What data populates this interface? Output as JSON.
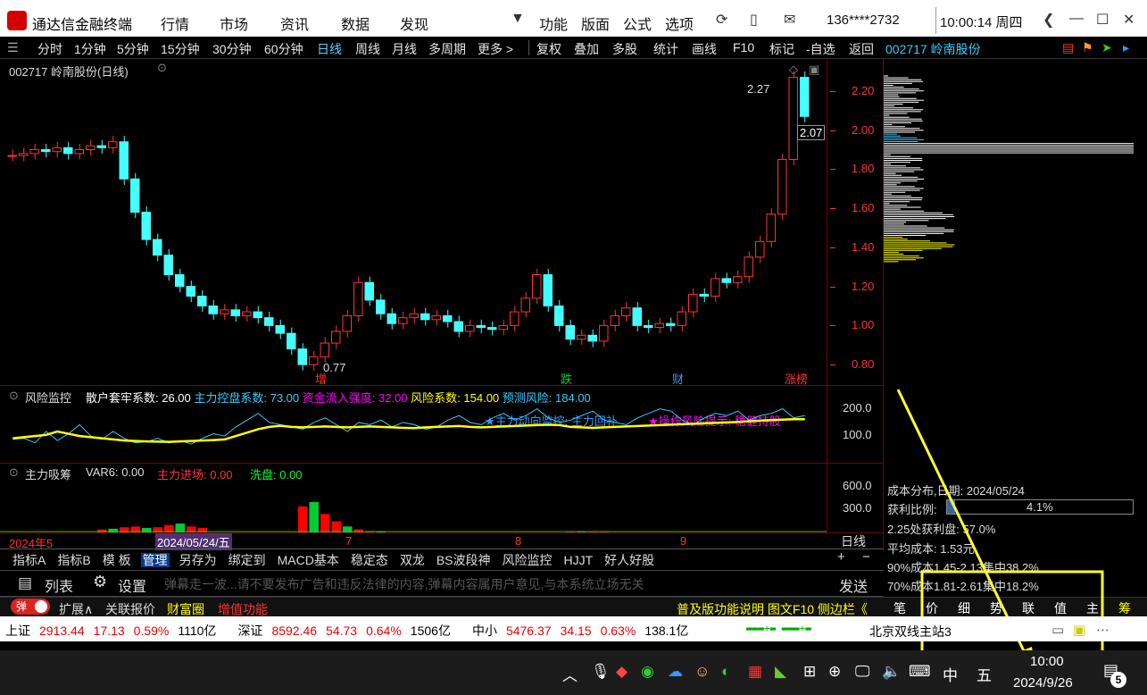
{
  "app": {
    "title": "通达信金融终端",
    "menus": [
      "行情",
      "市场",
      "资讯",
      "数据",
      "发现"
    ],
    "menus2": [
      "功能",
      "版面",
      "公式",
      "选项"
    ],
    "account": "136****2732",
    "time": "10:00:14 周四"
  },
  "periods": [
    "分时",
    "1分钟",
    "5分钟",
    "15分钟",
    "30分钟",
    "60分钟",
    "日线",
    "周线",
    "月线",
    "多周期",
    "更多 >"
  ],
  "tools": [
    "复权",
    "叠加",
    "多股",
    "统计",
    "画线",
    "F10",
    "标记",
    "-自选",
    "返回"
  ],
  "stock": {
    "header": "002717 岭南股份(日线)",
    "side_code": "002717 岭南股份",
    "high_label": "2.27",
    "low_label": "0.77",
    "last_label": "2.07",
    "yticks": [
      "2.20",
      "2.00",
      "1.80",
      "1.60",
      "1.40",
      "1.20",
      "1.00",
      "0.80"
    ],
    "markers": [
      {
        "t": "增",
        "c": "#f33"
      },
      {
        "t": "跌",
        "c": "#0c3"
      },
      {
        "t": "财",
        "c": "#39f"
      },
      {
        "t": "涨榜",
        "c": "#f33"
      }
    ]
  },
  "ind1": {
    "name": "风险监控",
    "items": [
      {
        "t": "散户套牢系数: 26.00",
        "c": "#fff"
      },
      {
        "t": "主力控盘系数: 73.00",
        "c": "#3cf"
      },
      {
        "t": "资金流入强度: 32.00",
        "c": "#f0f"
      },
      {
        "t": "风险系数: 154.00",
        "c": "#ff0"
      },
      {
        "t": "预测风险: 184.00",
        "c": "#3cf"
      }
    ],
    "note1": "★主力动向监控: 主力回补",
    "note2": "★操作风险提示: 稳健持股",
    "yticks": [
      "200.0",
      "100.0"
    ]
  },
  "ind2": {
    "name": "主力吸筹",
    "var": "VAR6: 0.00",
    "enter": "主力进场: 0.00",
    "wash": "洗盘: 0.00",
    "yticks": [
      "600.0",
      "300.0"
    ]
  },
  "timeaxis": {
    "a": "2024年5",
    "b": "2024/05/24/五",
    "c": "7",
    "d": "8",
    "e": "9",
    "period": "日线"
  },
  "tabs": [
    "指标A",
    "指标B",
    "模 板",
    "管理",
    "另存为",
    "绑定到",
    "MACD基本",
    "稳定态",
    "双龙",
    "BS波段神",
    "风险监控",
    "HJJT",
    "好人好股"
  ],
  "chatbar": {
    "list": "列表",
    "settings": "设置",
    "placeholder": "弹幕走一波...请不要发布广告和违反法律的内容,弹幕内容属用户意见,与本系统立场无关",
    "send": "发送"
  },
  "funcbar": {
    "toggle": "弹",
    "expand": "扩展∧",
    "related": "关联报价",
    "wealth": "财富圈",
    "value_add": "增值功能",
    "right": "普及版功能说明 图文F10 侧边栏《"
  },
  "sidetabs": [
    "笔",
    "价",
    "细",
    "势",
    "联",
    "值",
    "主",
    "筹"
  ],
  "cost": {
    "date": "成本分布,日期: 2024/05/24",
    "ratio_label": "获利比例:",
    "ratio": "4.1%",
    "p225": "2.25处获利盘: 57.0%",
    "avg": "平均成本: 1.53元",
    "c90": "90%成本1.45-2.13集中38.2%",
    "c70": "70%成本1.81-2.61集中18.2%"
  },
  "market": [
    {
      "n": "上证",
      "v": "2913.44",
      "c": "17.13",
      "p": "0.59%",
      "a": "1110亿"
    },
    {
      "n": "深证",
      "v": "8592.46",
      "c": "54.73",
      "p": "0.64%",
      "a": "1506亿"
    },
    {
      "n": "中小",
      "v": "5476.37",
      "c": "34.15",
      "p": "0.63%",
      "a": "138.1亿"
    }
  ],
  "server": "北京双线主站3",
  "taskbar": {
    "ime1": "中",
    "ime2": "五",
    "time": "10:00",
    "date": "2024/9/26",
    "notif": "5"
  },
  "colors": {
    "up": "#f33",
    "down": "#4ff",
    "yellow": "#ff0",
    "annot": "#ff3"
  },
  "chart_data": {
    "type": "candlestick",
    "title": "002717 岭南股份(日线)",
    "ylim": [
      0.7,
      2.3
    ],
    "y_range_label": "price",
    "candles_close": [
      1.87,
      1.88,
      1.9,
      1.89,
      1.91,
      1.88,
      1.9,
      1.92,
      1.91,
      1.94,
      1.75,
      1.58,
      1.44,
      1.36,
      1.26,
      1.2,
      1.15,
      1.1,
      1.06,
      1.08,
      1.05,
      1.07,
      1.04,
      1.0,
      0.96,
      0.88,
      0.8,
      0.84,
      0.91,
      0.97,
      1.05,
      1.22,
      1.13,
      1.06,
      1.01,
      1.04,
      1.06,
      1.03,
      1.05,
      1.02,
      0.97,
      1.0,
      0.99,
      0.98,
      1.0,
      1.07,
      1.14,
      1.26,
      1.1,
      1.0,
      0.93,
      0.95,
      0.92,
      1.0,
      1.05,
      1.09,
      1.0,
      0.99,
      1.01,
      1.0,
      1.07,
      1.16,
      1.15,
      1.24,
      1.22,
      1.25,
      1.35,
      1.43,
      1.57,
      1.85,
      2.27,
      2.07
    ],
    "ind1_line": [
      95,
      100,
      80,
      130,
      90,
      120,
      160,
      110,
      95,
      130,
      100,
      80,
      85,
      100,
      80,
      90,
      75,
      100,
      120,
      110,
      150,
      180,
      210,
      170,
      160,
      150,
      140,
      170,
      190,
      160,
      130,
      170,
      160,
      180,
      150,
      170,
      160,
      140,
      150,
      180,
      200,
      170,
      160,
      190,
      210,
      180,
      200,
      230,
      190,
      170,
      180,
      200,
      220,
      180,
      170,
      160,
      190,
      210,
      230,
      220,
      180,
      160,
      190,
      210,
      200,
      220,
      180,
      200,
      210,
      230,
      190,
      200
    ],
    "ind1_yellow": [
      100,
      105,
      110,
      115,
      130,
      120,
      110,
      105,
      100,
      95,
      90,
      88,
      86,
      85,
      84,
      86,
      88,
      90,
      92,
      95,
      110,
      125,
      140,
      150,
      155,
      150,
      148,
      150,
      152,
      150,
      148,
      150,
      152,
      150,
      148,
      146,
      145,
      148,
      150,
      152,
      154,
      150,
      148,
      150,
      152,
      154,
      156,
      158,
      160,
      158,
      150,
      148,
      146,
      148,
      150,
      152,
      154,
      156,
      158,
      160,
      162,
      164,
      166,
      168,
      170,
      172,
      175,
      178,
      180,
      182,
      184,
      184
    ],
    "ind2_bars": [
      0,
      0,
      0,
      0,
      0,
      0,
      0,
      0,
      40,
      50,
      70,
      80,
      60,
      70,
      100,
      120,
      80,
      60,
      0,
      0,
      0,
      0,
      0,
      0,
      0,
      0,
      350,
      410,
      250,
      150,
      80,
      40,
      20,
      10,
      0,
      0,
      0,
      0,
      0,
      0,
      0,
      0,
      0,
      0,
      0,
      0,
      0,
      0,
      0,
      0,
      5,
      5,
      5,
      5,
      0,
      0,
      0,
      0,
      0,
      0,
      0,
      0,
      0,
      0,
      0,
      0,
      0,
      0,
      0,
      0,
      0,
      0
    ]
  }
}
